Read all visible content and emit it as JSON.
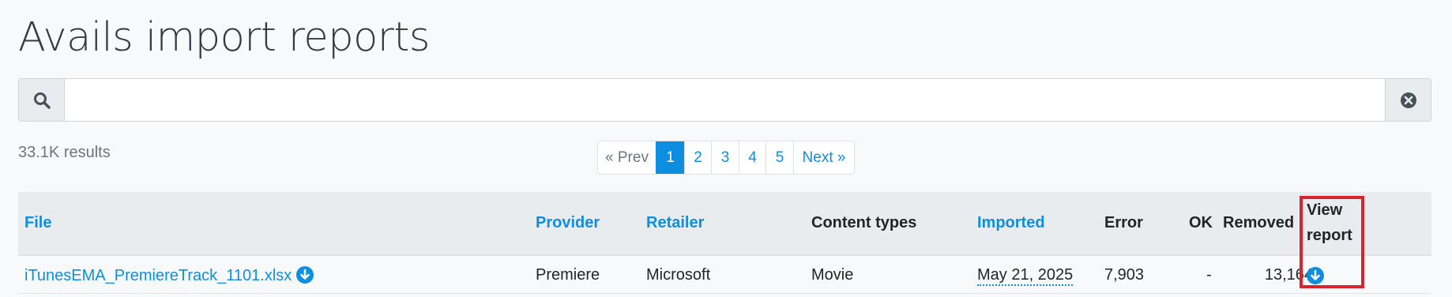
{
  "page": {
    "title": "Avails import reports"
  },
  "search": {
    "value": "",
    "placeholder": ""
  },
  "results_count": "33.1K results",
  "pagination": {
    "prev": "« Prev",
    "pages": [
      "1",
      "2",
      "3",
      "4",
      "5"
    ],
    "active": "1",
    "next": "Next »"
  },
  "table": {
    "columns": {
      "file": "File",
      "provider": "Provider",
      "retailer": "Retailer",
      "content_types": "Content types",
      "imported": "Imported",
      "error": "Error",
      "ok": "OK",
      "removed": "Removed",
      "view_report_line1": "View",
      "view_report_line2": "report"
    },
    "rows": [
      {
        "file": "iTunesEMA_PremiereTrack_1101.xlsx",
        "provider": "Premiere",
        "retailer": "Microsoft",
        "content_types": "Movie",
        "imported": "May 21, 2025",
        "error": "7,903",
        "ok": "-",
        "removed": "13,164"
      }
    ]
  },
  "colors": {
    "accent": "#0d8ee0",
    "highlight": "#d9232e"
  },
  "icons": {
    "search": "search-icon",
    "clear": "clear-circle-icon",
    "download": "download-circle-icon"
  }
}
